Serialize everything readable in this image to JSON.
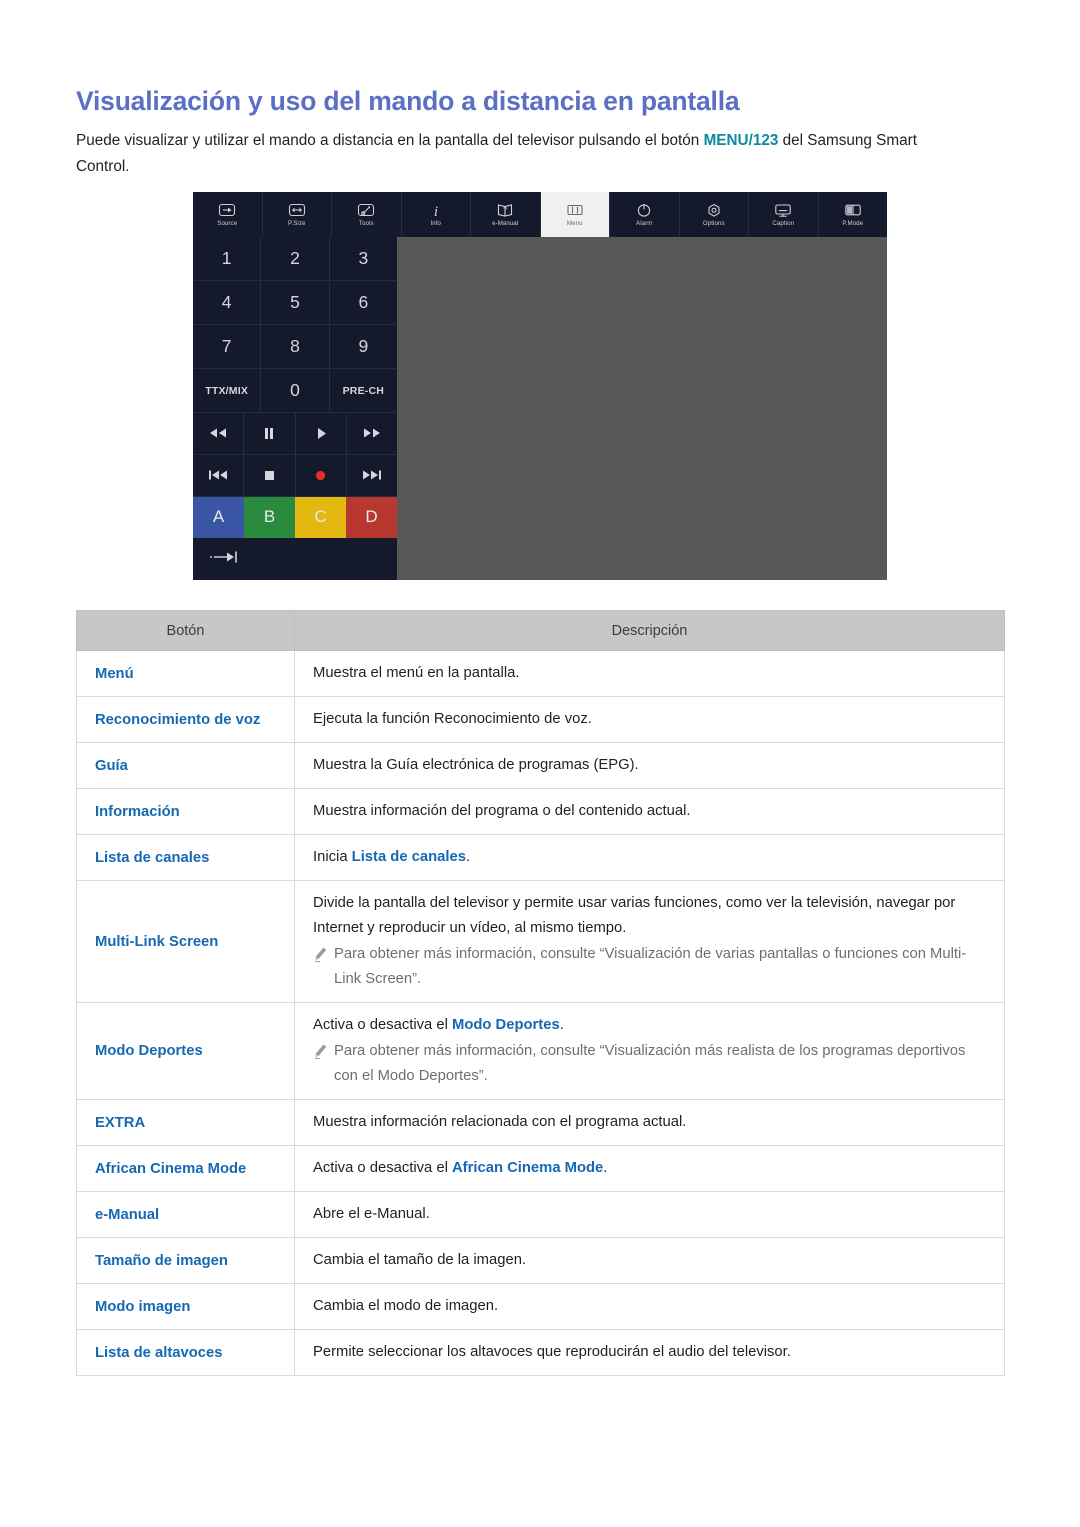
{
  "page": {
    "heading": "Visualización y uso del mando a distancia en pantalla",
    "intro_part1": "Puede visualizar y utilizar el mando a distancia en la pantalla del televisor pulsando el botón ",
    "intro_highlight": "MENU/123",
    "intro_part2": " del Samsung Smart Control."
  },
  "colors": {
    "heading": "#5b6fc4",
    "link_blue": "#1668b3",
    "highlight_teal": "#0d8a9e",
    "remote_dark": "#141a2c",
    "remote_gray": "#5a5857",
    "table_header_bg": "#c6c7c9",
    "color_a": "#3b55a5",
    "color_b": "#2a8a3e",
    "color_c": "#e3b810",
    "color_d": "#b8372f"
  },
  "remote": {
    "top_buttons": [
      {
        "label": "Source",
        "icon": "source-icon",
        "active": false
      },
      {
        "label": "P.Size",
        "icon": "picture-size-icon",
        "active": false
      },
      {
        "label": "Tools",
        "icon": "tools-icon",
        "active": false
      },
      {
        "label": "Info",
        "icon": "info-icon",
        "active": false
      },
      {
        "label": "e-Manual",
        "icon": "e-manual-icon",
        "active": false
      },
      {
        "label": "Menu",
        "icon": "menu-icon",
        "active": true
      },
      {
        "label": "Alarm",
        "icon": "alarm-icon",
        "active": false
      },
      {
        "label": "Options",
        "icon": "options-icon",
        "active": false
      },
      {
        "label": "Caption",
        "icon": "caption-icon",
        "active": false
      },
      {
        "label": "P.Mode",
        "icon": "picture-mode-icon",
        "active": false
      }
    ],
    "keypad": [
      [
        "1",
        "2",
        "3"
      ],
      [
        "4",
        "5",
        "6"
      ],
      [
        "7",
        "8",
        "9"
      ],
      [
        "TTX/MIX",
        "0",
        "PRE-CH"
      ]
    ],
    "media_row_1": [
      "rewind-icon",
      "pause-icon",
      "play-icon",
      "fast-forward-icon"
    ],
    "media_row_2": [
      "previous-icon",
      "stop-icon",
      "record-icon",
      "next-icon"
    ],
    "color_buttons": [
      {
        "label": "A",
        "color": "#3b55a5"
      },
      {
        "label": "B",
        "color": "#2a8a3e"
      },
      {
        "label": "C",
        "color": "#e3b810"
      },
      {
        "label": "D",
        "color": "#b8372f"
      }
    ],
    "bottom_icon": "tab-exit-icon"
  },
  "table": {
    "headers": [
      "Botón",
      "Descripción"
    ],
    "rows": [
      {
        "button": "Menú",
        "desc_pre": "Muestra el menú en la pantalla.",
        "desc_blue": "",
        "desc_post": "",
        "note": ""
      },
      {
        "button": "Reconocimiento de voz",
        "desc_pre": "Ejecuta la función Reconocimiento de voz.",
        "desc_blue": "",
        "desc_post": "",
        "note": ""
      },
      {
        "button": "Guía",
        "desc_pre": "Muestra la Guía electrónica de programas (EPG).",
        "desc_blue": "",
        "desc_post": "",
        "note": ""
      },
      {
        "button": "Información",
        "desc_pre": "Muestra información del programa o del contenido actual.",
        "desc_blue": "",
        "desc_post": "",
        "note": ""
      },
      {
        "button": "Lista de canales",
        "desc_pre": "Inicia ",
        "desc_blue": "Lista de canales",
        "desc_post": ".",
        "note": ""
      },
      {
        "button": "Multi-Link Screen",
        "desc_pre": "Divide la pantalla del televisor y permite usar varias funciones, como ver la televisión, navegar por Internet y reproducir un vídeo, al mismo tiempo.",
        "desc_blue": "",
        "desc_post": "",
        "note": "Para obtener más información, consulte “Visualización de varias pantallas o funciones con Multi-Link Screen”."
      },
      {
        "button": "Modo Deportes",
        "desc_pre": "Activa o desactiva el ",
        "desc_blue": "Modo Deportes",
        "desc_post": ".",
        "note": "Para obtener más información, consulte “Visualización más realista de los programas deportivos con el Modo Deportes”."
      },
      {
        "button": "EXTRA",
        "desc_pre": "Muestra información relacionada con el programa actual.",
        "desc_blue": "",
        "desc_post": "",
        "note": ""
      },
      {
        "button": "African Cinema Mode",
        "desc_pre": "Activa o desactiva el ",
        "desc_blue": "African Cinema Mode",
        "desc_post": ".",
        "note": ""
      },
      {
        "button": "e-Manual",
        "desc_pre": "Abre el e-Manual.",
        "desc_blue": "",
        "desc_post": "",
        "note": ""
      },
      {
        "button": "Tamaño de imagen",
        "desc_pre": "Cambia el tamaño de la imagen.",
        "desc_blue": "",
        "desc_post": "",
        "note": ""
      },
      {
        "button": "Modo imagen",
        "desc_pre": "Cambia el modo de imagen.",
        "desc_blue": "",
        "desc_post": "",
        "note": ""
      },
      {
        "button": "Lista de altavoces",
        "desc_pre": "Permite seleccionar los altavoces que reproducirán el audio del televisor.",
        "desc_blue": "",
        "desc_post": "",
        "note": ""
      }
    ]
  }
}
